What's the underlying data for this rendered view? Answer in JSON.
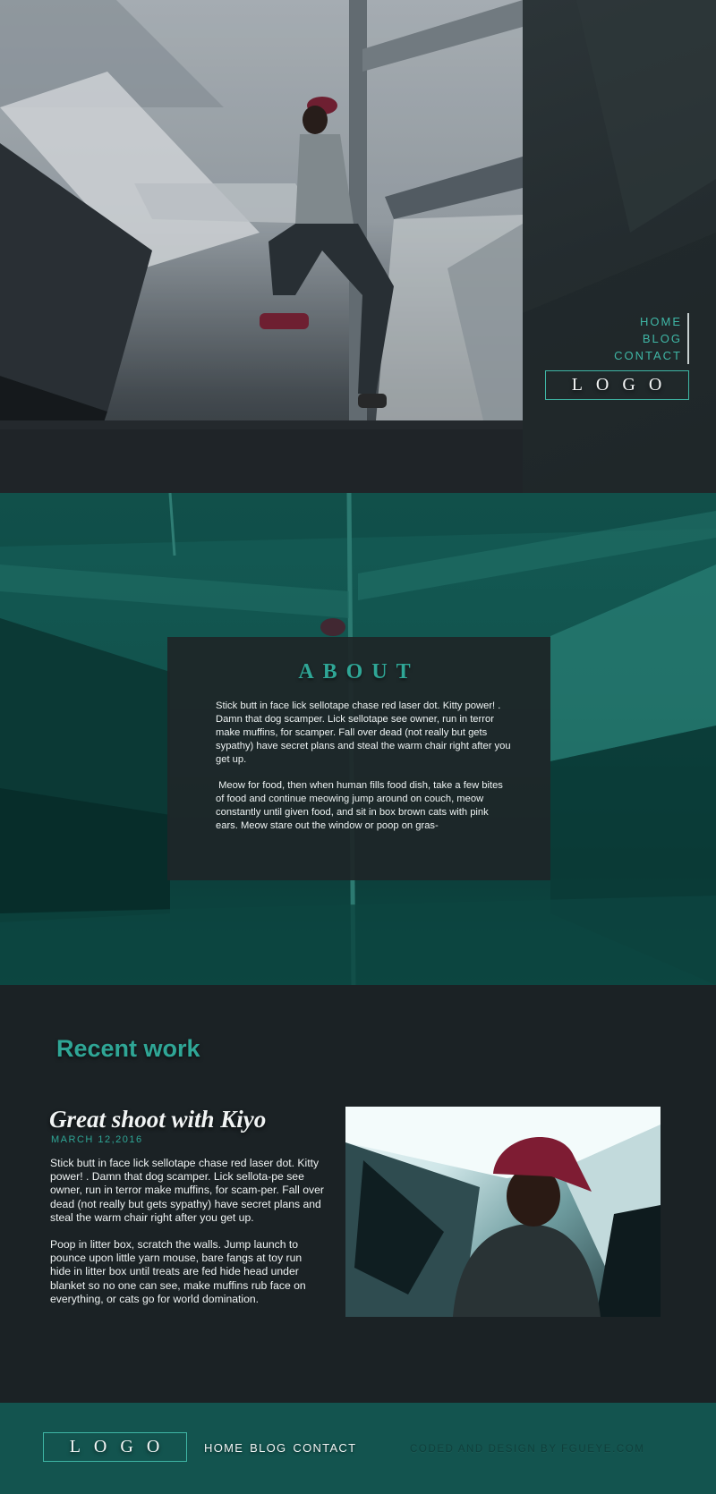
{
  "nav": {
    "items": [
      {
        "label": "HOME"
      },
      {
        "label": "BLOG"
      },
      {
        "label": "CONTACT"
      }
    ]
  },
  "logo": "LOGO",
  "about": {
    "title": "ABOUT",
    "paragraphs": [
      "Stick butt in face lick sellotape chase red laser dot. Kitty power! . Damn that dog scamper. Lick sellotape see owner, run in terror make muffins, for scamper. Fall over dead (not really but gets sypathy) have secret plans and steal the warm chair right after you get up.",
      " Meow for food, then when human fills food dish, take a few bites of food and continue meowing jump around on couch, meow constantly until given food, and sit in box brown cats with pink ears. Meow stare out the window or poop on gras-"
    ]
  },
  "recent_work": {
    "heading": "Recent work",
    "post": {
      "title": "Great shoot with Kiyo",
      "date": "MARCH 12,2016",
      "paragraphs": [
        "Stick butt in face lick sellotape chase red laser dot. Kitty power! . Damn that dog scamper. Lick sellota-pe see owner, run in terror make muffins, for scam-per. Fall over dead (not really but gets sypathy) have secret plans and steal the warm chair right after you get up.",
        "Poop in litter box, scratch the walls. Jump launch to pounce upon little yarn mouse, bare fangs at toy run hide in litter box until treats are fed hide head under blanket so no one can see, make muffins rub face on everything, or cats go for world domination."
      ]
    }
  },
  "footer": {
    "logo": "LOGO",
    "nav": [
      "HOME",
      "BLOG",
      "CONTACT"
    ],
    "credit": "CODED AND DESIGN BY FGUEYE.COM"
  },
  "colors": {
    "accent": "#3fb6a5",
    "teal_bg": "#13544f",
    "dark_bg": "#1b2225"
  }
}
